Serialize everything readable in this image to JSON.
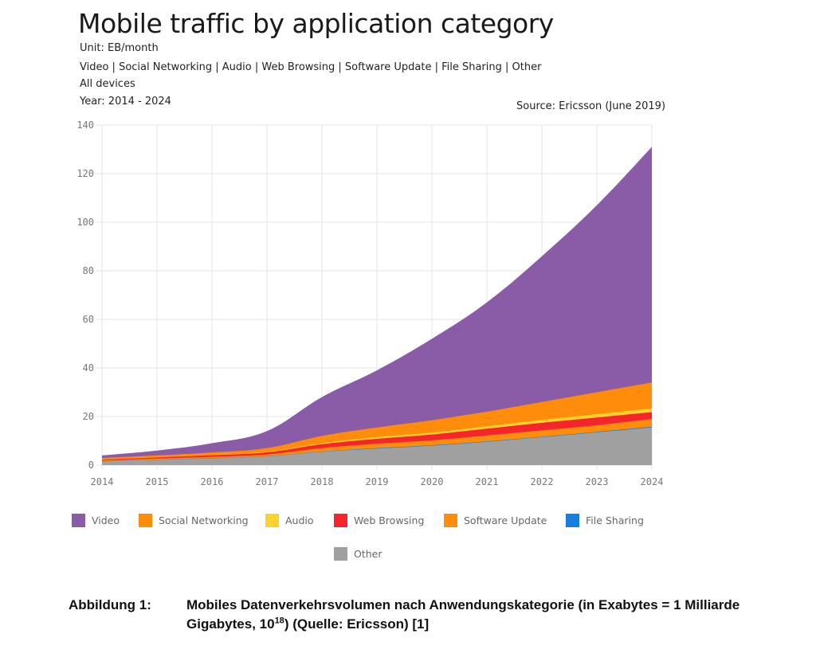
{
  "header": {
    "title": "Mobile traffic by application category",
    "unit": "Unit: EB/month",
    "categories_line": "Video | Social Networking | Audio | Web Browsing | Software Update | File Sharing | Other",
    "devices": "All devices",
    "years": "Year: 2014 - 2024",
    "source": "Source: Ericsson (June 2019)"
  },
  "caption": {
    "label": "Abbildung 1:",
    "text_before_sup": "Mobiles Datenverkehrsvolumen nach Anwendungskategorie (in Exabytes = 1 Milliarde Gigabytes, 10",
    "sup": "18",
    "text_after_sup": ") (Quelle: Ericsson) [1]"
  },
  "chart_data": {
    "type": "area",
    "stacked": true,
    "title": "Mobile traffic by application category",
    "xlabel": "",
    "ylabel": "EB/month",
    "x": [
      2014,
      2015,
      2016,
      2017,
      2018,
      2019,
      2020,
      2021,
      2022,
      2023,
      2024
    ],
    "x_ticks": [
      "2014",
      "2015",
      "2016",
      "2017",
      "2018",
      "2019",
      "2020",
      "2021",
      "2022",
      "2023",
      "2024"
    ],
    "ylim": [
      0,
      140
    ],
    "y_ticks": [
      0,
      20,
      40,
      60,
      80,
      100,
      120,
      140
    ],
    "grid": true,
    "legend_position": "bottom",
    "stack_order_bottom_to_top": [
      "Other",
      "File Sharing",
      "Software Update",
      "Web Browsing",
      "Audio",
      "Social Networking",
      "Video"
    ],
    "series": [
      {
        "name": "Other",
        "color": "#a0a0a0",
        "values": [
          1.5,
          2.2,
          2.8,
          3.6,
          5.5,
          6.8,
          8.0,
          9.6,
          11.5,
          13.5,
          15.5
        ]
      },
      {
        "name": "File Sharing",
        "color": "#1a7de0",
        "values": [
          0.1,
          0.1,
          0.1,
          0.1,
          0.1,
          0.2,
          0.2,
          0.2,
          0.2,
          0.2,
          0.3
        ]
      },
      {
        "name": "Software Update",
        "color": "#ff8c0a",
        "values": [
          0.3,
          0.4,
          0.5,
          0.7,
          1.4,
          1.8,
          2.0,
          2.4,
          2.6,
          2.7,
          3.2
        ]
      },
      {
        "name": "Web Browsing",
        "color": "#f5252d",
        "values": [
          0.4,
          0.5,
          0.7,
          0.9,
          1.6,
          2.0,
          2.4,
          2.8,
          3.1,
          3.2,
          2.8
        ]
      },
      {
        "name": "Audio",
        "color": "#fdd22c",
        "values": [
          0.1,
          0.1,
          0.1,
          0.2,
          0.4,
          0.7,
          0.8,
          1.0,
          1.2,
          1.4,
          1.5
        ]
      },
      {
        "name": "Social Networking",
        "color": "#ff8c0a",
        "values": [
          0.5,
          0.7,
          1.0,
          1.5,
          3.0,
          4.0,
          5.1,
          6.0,
          7.4,
          9.0,
          10.7
        ]
      },
      {
        "name": "Video",
        "color": "#8a5ca8",
        "values": [
          1.1,
          2.0,
          3.8,
          7.0,
          16.0,
          23.5,
          33.5,
          45.0,
          60.0,
          77.0,
          97.0
        ]
      }
    ],
    "legend": [
      {
        "name": "Video",
        "color": "#8a5ca8"
      },
      {
        "name": "Social Networking",
        "color": "#ff8c0a"
      },
      {
        "name": "Audio",
        "color": "#fdd22c"
      },
      {
        "name": "Web Browsing",
        "color": "#f5252d"
      },
      {
        "name": "Software Update",
        "color": "#ff8c0a"
      },
      {
        "name": "File Sharing",
        "color": "#1a7de0"
      },
      {
        "name": "Other",
        "color": "#a0a0a0"
      }
    ]
  }
}
